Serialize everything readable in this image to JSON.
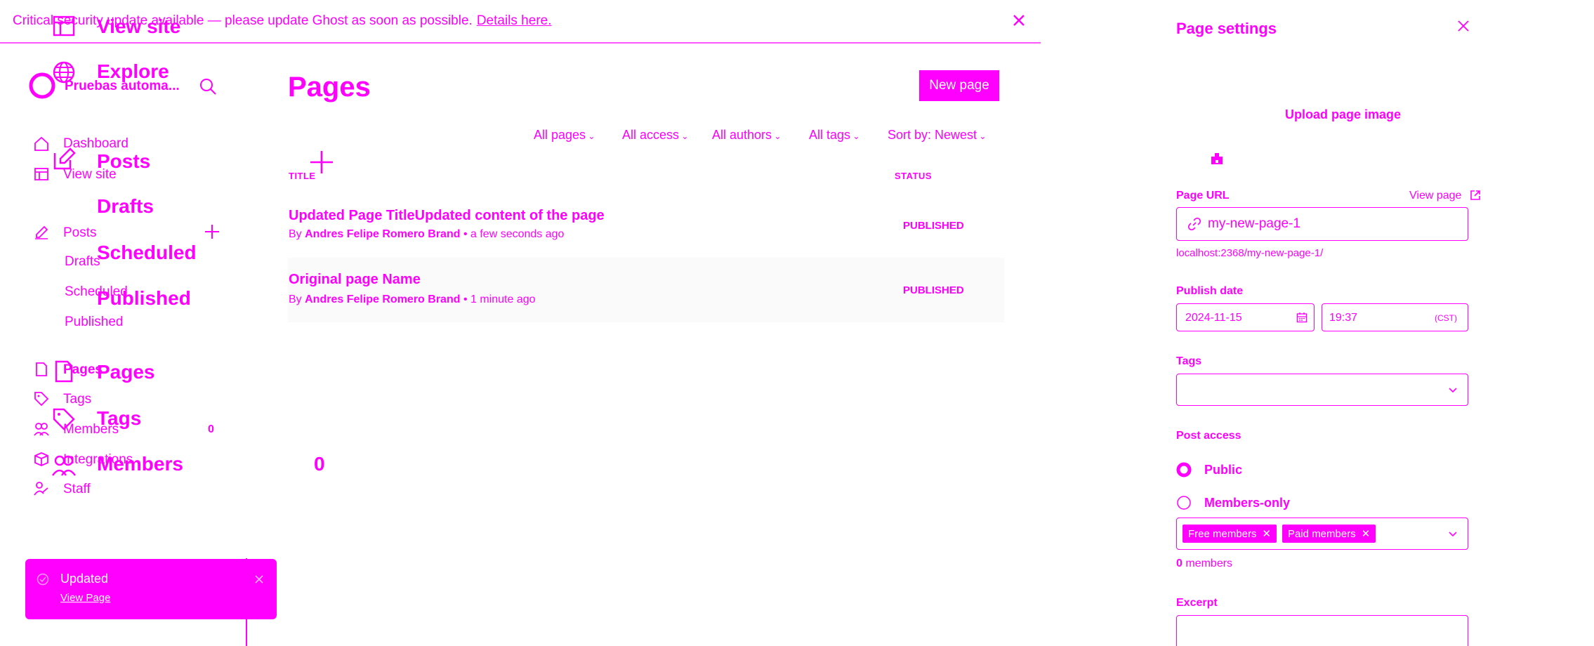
{
  "banner": {
    "text": "Critical security update available — please update Ghost as soon as possible.",
    "link": "Details here."
  },
  "sidebar": {
    "site_title": "Pruebas automa...",
    "items": [
      {
        "label": "Dashboard"
      },
      {
        "label": "View site"
      },
      {
        "label": "Posts"
      },
      {
        "label": "Drafts"
      },
      {
        "label": "Scheduled"
      },
      {
        "label": "Published"
      },
      {
        "label": "Pages"
      },
      {
        "label": "Tags"
      },
      {
        "label": "Members"
      },
      {
        "label": "Integrations"
      },
      {
        "label": "Staff"
      }
    ],
    "members_count": "0"
  },
  "overlay": {
    "labels": [
      "View site",
      "Explore",
      "Posts",
      "Drafts",
      "Scheduled",
      "Published",
      "Pages",
      "Tags",
      "Members"
    ],
    "members_count": "0"
  },
  "main": {
    "title": "Pages",
    "new_page_label": "New page",
    "filters": [
      "All pages",
      "All access",
      "All authors",
      "All tags",
      "Sort by: Newest"
    ],
    "columns": {
      "title": "TITLE",
      "status": "STATUS"
    },
    "rows": [
      {
        "title": "Updated Page TitleUpdated content of the page",
        "by": "By",
        "author": "Andres Felipe Romero Brand",
        "time": "• a few seconds ago",
        "status": "PUBLISHED"
      },
      {
        "title": "Original page Name",
        "by": "By",
        "author": "Andres Felipe Romero Brand",
        "time": "• 1 minute ago",
        "status": "PUBLISHED"
      }
    ]
  },
  "toast": {
    "message": "Updated",
    "link": "View Page"
  },
  "settings": {
    "title": "Page settings",
    "upload_label": "Upload page image",
    "page_url_label": "Page URL",
    "view_page_label": "View page",
    "slug": "my-new-page-1",
    "url_preview": "localhost:2368/my-new-page-1/",
    "publish_date_label": "Publish date",
    "date": "2024-11-15",
    "time": "19:37",
    "timezone": "(CST)",
    "tags_label": "Tags",
    "post_access_label": "Post access",
    "access_options": [
      {
        "label": "Public",
        "selected": true
      },
      {
        "label": "Members-only",
        "selected": false
      }
    ],
    "tiers": [
      "Free members",
      "Paid members"
    ],
    "members_count_number": "0",
    "members_count_suffix": "members",
    "excerpt_label": "Excerpt"
  },
  "colors": {
    "accent": "#ff00ff",
    "background": "#ffffff"
  }
}
